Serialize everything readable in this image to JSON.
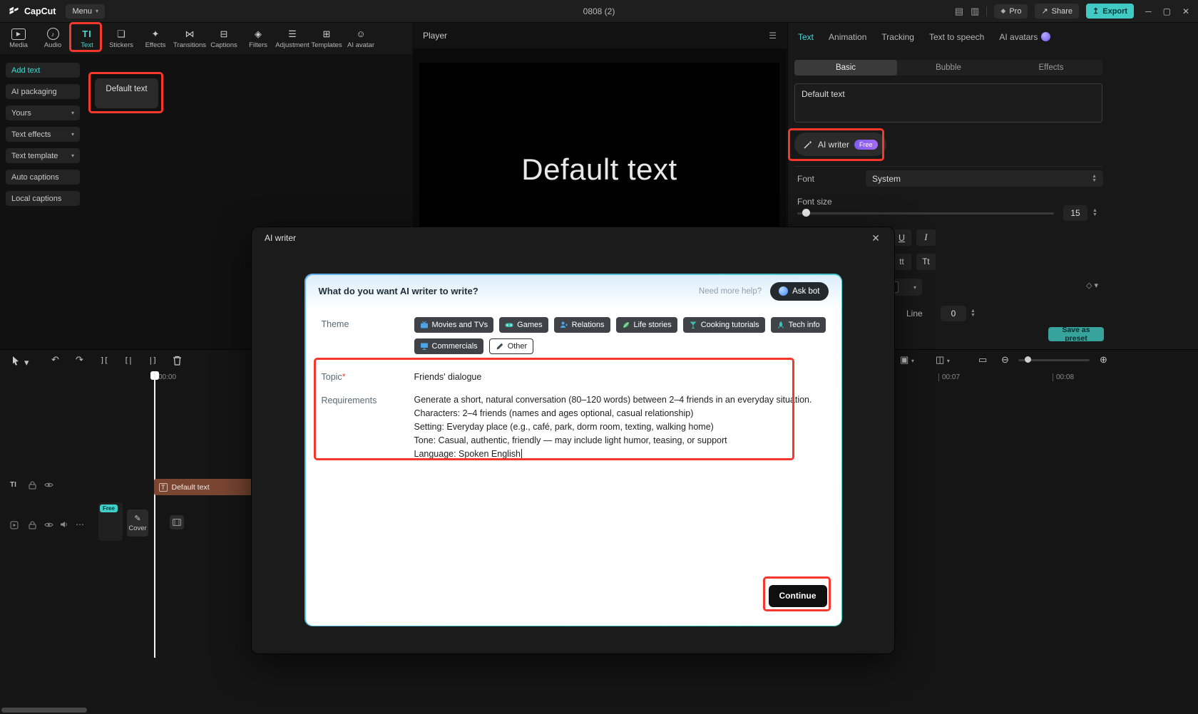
{
  "topbar": {
    "logo": "CapCut",
    "menu_label": "Menu",
    "doc_title": "0808 (2)",
    "pro_label": "Pro",
    "share_label": "Share",
    "export_label": "Export"
  },
  "ribbon": {
    "items": [
      "Media",
      "Audio",
      "Text",
      "Stickers",
      "Effects",
      "Transitions",
      "Captions",
      "Filters",
      "Adjustment",
      "Templates",
      "AI avatar"
    ]
  },
  "left_panel": {
    "nav": [
      "Add text",
      "AI packaging",
      "Yours",
      "Text effects",
      "Text template",
      "Auto captions",
      "Local captions"
    ],
    "card_label": "Default text"
  },
  "player": {
    "title": "Player",
    "preview_text": "Default text"
  },
  "inspector": {
    "tabs": [
      "Text",
      "Animation",
      "Tracking",
      "Text to speech",
      "AI avatars"
    ],
    "subtabs": [
      "Basic",
      "Bubble",
      "Effects"
    ],
    "text_value": "Default text",
    "ai_writer_label": "AI writer",
    "ai_writer_badge": "Free",
    "font_label": "Font",
    "font_value": "System",
    "font_size_label": "Font size",
    "font_size_value": "15",
    "underline": "U",
    "italic": "I",
    "lowercase": "tt",
    "titlecase": "Tt",
    "line_label": "Line",
    "line_value": "0",
    "save_preset_label": "Save as preset"
  },
  "timeline": {
    "time_zero": "00:00",
    "mark_a": "00:07",
    "mark_b": "00:08",
    "clip_label": "Default text",
    "clip_icon": "T",
    "cover_label": "Cover",
    "free_badge": "Free"
  },
  "modal": {
    "title": "AI writer",
    "question": "What do you want AI writer to write?",
    "help_text": "Need more help?",
    "ask_bot_label": "Ask bot",
    "theme_label": "Theme",
    "themes": [
      {
        "icon": "tv-icon",
        "label": "Movies and TVs"
      },
      {
        "icon": "gamepad-icon",
        "label": "Games"
      },
      {
        "icon": "people-icon",
        "label": "Relations"
      },
      {
        "icon": "leaf-icon",
        "label": "Life stories"
      },
      {
        "icon": "cocktail-icon",
        "label": "Cooking tutorials"
      },
      {
        "icon": "rocket-icon",
        "label": "Tech info"
      },
      {
        "icon": "monitor-icon",
        "label": "Commercials"
      },
      {
        "icon": "pencil-icon",
        "label": "Other"
      }
    ],
    "topic_label": "Topic",
    "topic_required_mark": "*",
    "topic_value": "Friends' dialogue",
    "requirements_label": "Requirements",
    "requirements_lines": [
      "Generate a short, natural conversation (80–120 words) between 2–4 friends in an everyday situation.",
      "Characters: 2–4 friends (names and ages optional, casual relationship)",
      "Setting: Everyday place (e.g., café, park, dorm room, texting, walking home)",
      "Tone: Casual, authentic, friendly — may include light humor, teasing, or support",
      "Language: Spoken English"
    ],
    "continue_label": "Continue"
  }
}
